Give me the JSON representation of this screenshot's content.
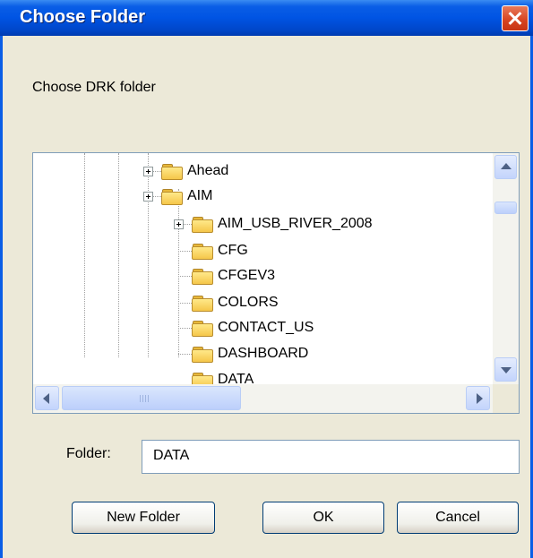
{
  "dialog": {
    "title": "Choose Folder",
    "prompt": "Choose DRK folder"
  },
  "tree": {
    "items": [
      {
        "label": "Ahead",
        "expandable": true
      },
      {
        "label": "AIM",
        "expandable": true
      },
      {
        "label": "AIM_USB_RIVER_2008",
        "expandable": true
      },
      {
        "label": "CFG",
        "expandable": false
      },
      {
        "label": "CFGEV3",
        "expandable": false
      },
      {
        "label": "COLORS",
        "expandable": false
      },
      {
        "label": "CONTACT_US",
        "expandable": false
      },
      {
        "label": "DASHBOARD",
        "expandable": false
      },
      {
        "label": "DATA",
        "expandable": false
      }
    ]
  },
  "folder_field": {
    "label": "Folder:",
    "value": "DATA"
  },
  "buttons": {
    "new_folder": "New Folder",
    "ok": "OK",
    "cancel": "Cancel"
  },
  "colors": {
    "titlebar": "#0054e3",
    "dialog_bg": "#ece9d8",
    "close_button": "#d6421f"
  }
}
